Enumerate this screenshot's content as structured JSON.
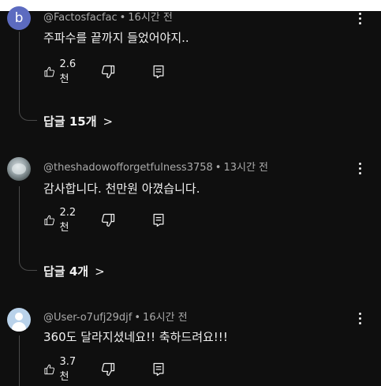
{
  "comments": [
    {
      "avatar_letter": "b",
      "avatar_color": "#5c6bc0",
      "author": "@Factosfacfac",
      "time": "16시간 전",
      "text": "주파수를 끝까지 들었어야지..",
      "likes": "2.6천",
      "replies_label": "답글 15개"
    },
    {
      "author": "@theshadowofforgetfulness3758",
      "time": "13시간 전",
      "text": "감사합니다. 천만원 아꼈습니다.",
      "likes": "2.2천",
      "replies_label": "답글 4개"
    },
    {
      "author": "@User-o7ufj29djf",
      "time": "16시간 전",
      "text": "360도 달라지셨네요!! 축하드려요!!!",
      "likes": "3.7천"
    }
  ],
  "separator": "•",
  "chevron": ">",
  "icons": {
    "like": "thumbs-up-icon",
    "dislike": "thumbs-down-icon",
    "reply": "comment-icon",
    "more": "more-vertical-icon"
  }
}
